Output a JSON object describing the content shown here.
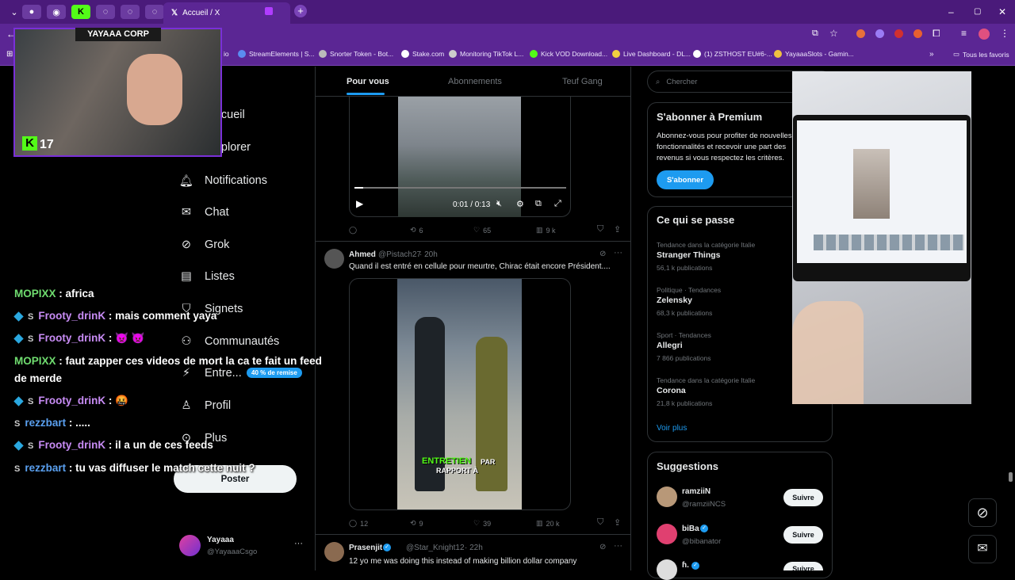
{
  "browser": {
    "tab_title": "Accueil / X",
    "bookmarks": [
      "StreamElements | S...",
      "Snorter Token - Bot...",
      "Stake.com",
      "Monitoring TikTok L...",
      "Kick VOD Download...",
      "Live Dashboard - DL...",
      "(1) ZSTHOST EU#6-...",
      "YayaaaSlots - Gamin..."
    ],
    "all_bookmarks": "Tous les favoris",
    "bm_partial": "io"
  },
  "webcam": {
    "label": "YAYAAA CORP",
    "viewer_count": "17"
  },
  "nav": {
    "items": [
      "Accueil",
      "Explorer",
      "Notifications",
      "Chat",
      "Grok",
      "Listes",
      "Signets",
      "Communautés",
      "Entre...",
      "Profil",
      "Plus"
    ],
    "promo_badge": "40 % de remise",
    "post_button": "Poster",
    "account_name": "Yayaaa",
    "account_handle": "@YayaaaCsgo"
  },
  "feed": {
    "tabs": [
      "Pour vous",
      "Abonnements",
      "Teuf Gang"
    ],
    "post1": {
      "video_time": "0:01 / 0:13",
      "replies": "",
      "reposts": "6",
      "likes": "65",
      "views": "9 k"
    },
    "post2": {
      "name": "Ahmed",
      "handle": "@Pistach27",
      "time": "· 20h",
      "text": "Quand il est entré en cellule pour meurtre, Chirac était encore Président....",
      "caption_green": "ENTRETIEN",
      "caption_white": "PAR",
      "caption_line2": "RAPPORT À",
      "replies": "12",
      "reposts": "9",
      "likes": "39",
      "views": "20 k"
    },
    "post3": {
      "name": "Prasenjit",
      "handle": "@Star_Knight12",
      "time": "· 22h",
      "text": "12 yo me was doing this instead of making billion dollar company"
    }
  },
  "right": {
    "search_placeholder": "Chercher",
    "premium": {
      "title": "S'abonner à Premium",
      "text": "Abonnez-vous pour profiter de nouvelles fonctionnalités et recevoir une part des revenus si vous respectez les critères.",
      "button": "S'abonner"
    },
    "trends": {
      "title": "Ce qui se passe",
      "items": [
        {
          "cat": "Tendance dans la catégorie Italie",
          "name": "Stranger Things",
          "count": "56,1 k publications"
        },
        {
          "cat": "Politique · Tendances",
          "name": "Zelensky",
          "count": "68,3 k publications"
        },
        {
          "cat": "Sport · Tendances",
          "name": "Allegri",
          "count": "7 866 publications"
        },
        {
          "cat": "Tendance dans la catégorie Italie",
          "name": "Corona",
          "count": "21,8 k publications"
        }
      ],
      "more": "Voir plus"
    },
    "suggestions": {
      "title": "Suggestions",
      "items": [
        {
          "name": "ramziiN",
          "handle": "@ramziiNCS",
          "button": "Suivre"
        },
        {
          "name": "biBa",
          "handle": "@bibanator",
          "button": "Suivre"
        },
        {
          "name": "ɦ.",
          "handle": "",
          "button": "Suivre"
        }
      ]
    }
  },
  "chat": [
    {
      "user": "MOPIXX",
      "msg": " : africa",
      "color": "u1",
      "badges": false
    },
    {
      "user": "Frooty_drinK",
      "msg": " : mais comment yaya",
      "color": "u2",
      "badges": true
    },
    {
      "user": "Frooty_drinK",
      "msg": " : 👿 👿",
      "color": "u2",
      "badges": true
    },
    {
      "user": "MOPIXX",
      "msg": " : faut zapper ces videos de mort la ca te fait un feed",
      "color": "u1",
      "badges": false
    },
    {
      "user": "",
      "msg": "de merde",
      "color": "u1",
      "badges": false
    },
    {
      "user": "Frooty_drinK",
      "msg": " : 🤬",
      "color": "u2",
      "badges": true
    },
    {
      "user": "rezzbart",
      "msg": " : .....",
      "color": "u3",
      "badges": true
    },
    {
      "user": "Frooty_drinK",
      "msg": " : il a un de ces feeds",
      "color": "u2",
      "badges": true
    },
    {
      "user": "rezzbart",
      "msg": " : tu vas diffuser le match cette nuit ?",
      "color": "u3",
      "badges": true
    }
  ],
  "colors": {
    "accent": "#1d9bf0",
    "browser": "#5b2694",
    "chat_green": "#6fdc6f"
  }
}
